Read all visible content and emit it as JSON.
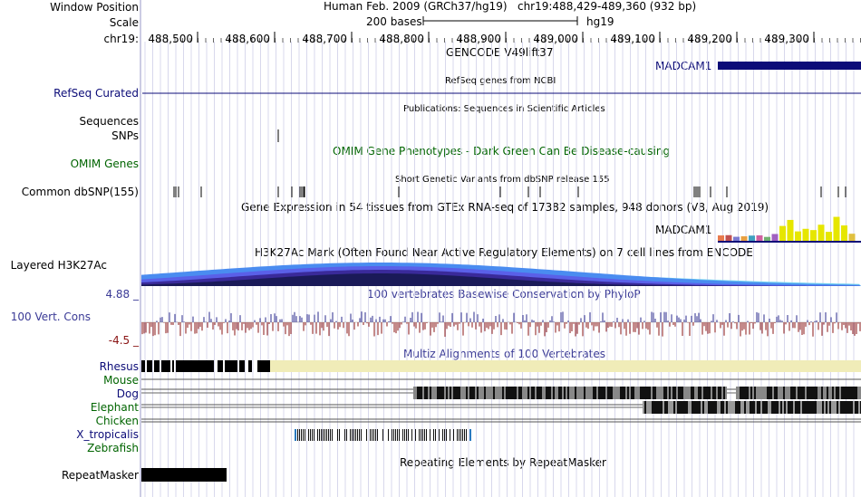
{
  "header": {
    "window_position_label": "Window Position",
    "scale_label": "Scale",
    "chrom_label": "chr19:",
    "assembly": "Human Feb. 2009 (GRCh37/hg19)",
    "position": "chr19:488,429-489,360 (932 bp)",
    "scale_text": "200 bases",
    "db": "hg19",
    "ticks": [
      "488,500",
      "488,600",
      "488,700",
      "488,800",
      "488,900",
      "489,000",
      "489,100",
      "489,200",
      "489,300"
    ]
  },
  "tracks": {
    "gencode_title": "GENCODE V49lift37",
    "gencode_gene": "MADCAM1",
    "refseq_label": "RefSeq Curated",
    "refseq_title": "RefSeq genes from NCBI",
    "pubs_title": "Publications: Sequences in Scientific Articles",
    "sequences_label": "Sequences",
    "snps_label": "SNPs",
    "omim_title": "OMIM Gene Phenotypes - Dark Green Can Be Disease-causing",
    "omim_label": "OMIM Genes",
    "dbsnp_title": "Short Genetic Variants from dbSNP release 155",
    "dbsnp_label": "Common dbSNP(155)",
    "gtex_title": "Gene Expression in 54 tissues from GTEx RNA-seq of 17382 samples, 948 donors (V8, Aug 2019)",
    "gtex_gene": "MADCAM1",
    "h3k27_title": "H3K27Ac Mark (Often Found Near Active Regulatory Elements) on 7 cell lines from ENCODE",
    "h3k27_label": "Layered H3K27Ac",
    "cons_title": "100 vertebrates Basewise Conservation by PhyloP",
    "cons_label": "100 Vert. Cons",
    "cons_max": "4.88 _",
    "cons_min": "-4.5 _",
    "multiz_title": "Multiz Alignments of 100 Vertebrates",
    "species": [
      "Rhesus",
      "Mouse",
      "Dog",
      "Elephant",
      "Chicken",
      "X_tropicalis",
      "Zebrafish"
    ],
    "repeat_title": "Repeating Elements by RepeatMasker",
    "repeat_label": "RepeatMasker"
  },
  "colors": {
    "navy": "#0c0c78",
    "omim_green": "#006400",
    "gtex_yellow": "#e6e600",
    "rhesus_fill": "#f0ecb8",
    "cons_pos": "#2a2a8c",
    "cons_neg": "#8a1414",
    "gridline": "#d8d8ec"
  }
}
